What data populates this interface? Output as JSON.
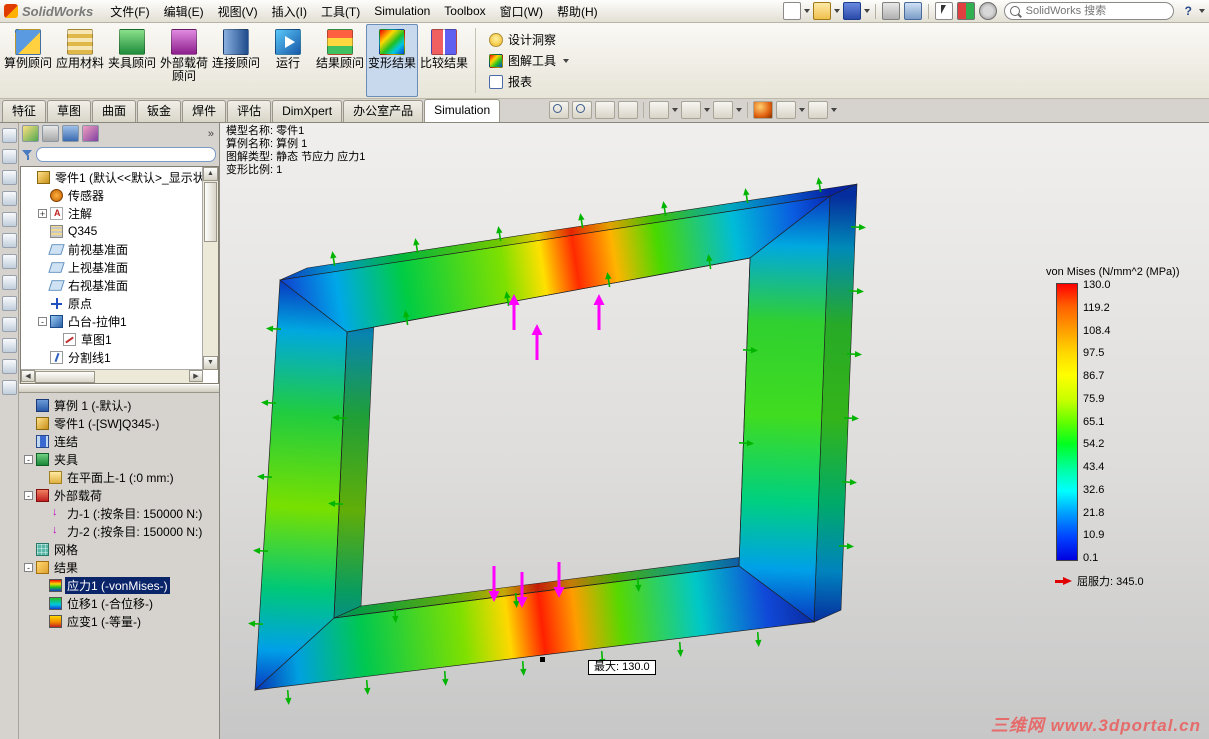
{
  "titlebar": {
    "logo": "SolidWorks",
    "menus": [
      {
        "label": "文件(F)"
      },
      {
        "label": "编辑(E)"
      },
      {
        "label": "视图(V)"
      },
      {
        "label": "插入(I)"
      },
      {
        "label": "工具(T)"
      },
      {
        "label": "Simulation"
      },
      {
        "label": "Toolbox"
      },
      {
        "label": "窗口(W)"
      },
      {
        "label": "帮助(H)"
      }
    ],
    "search_placeholder": "SolidWorks 搜索",
    "help_label": "?"
  },
  "ribbon": {
    "main_buttons": [
      {
        "label": "算例顾问",
        "icon": "ri-study"
      },
      {
        "label": "应用材料",
        "icon": "ri-material"
      },
      {
        "label": "夹具顾问",
        "icon": "ri-fixture"
      },
      {
        "label": "外部载荷顾问",
        "icon": "ri-load"
      },
      {
        "label": "连接顾问",
        "icon": "ri-connect"
      },
      {
        "label": "运行",
        "icon": "ri-run"
      },
      {
        "label": "结果顾问",
        "icon": "ri-resultadv"
      },
      {
        "label": "变形结果",
        "icon": "ri-deform",
        "active": true
      },
      {
        "label": "比较结果",
        "icon": "ri-compare"
      }
    ],
    "side_buttons": [
      {
        "label": "设计洞察",
        "icon": "si-insight"
      },
      {
        "label": "图解工具",
        "icon": "si-plot",
        "dropdown": true
      },
      {
        "label": "报表",
        "icon": "si-report"
      }
    ]
  },
  "tabs": {
    "items": [
      {
        "label": "特征"
      },
      {
        "label": "草图"
      },
      {
        "label": "曲面"
      },
      {
        "label": "钣金"
      },
      {
        "label": "焊件"
      },
      {
        "label": "评估"
      },
      {
        "label": "DimXpert"
      },
      {
        "label": "办公室产品"
      },
      {
        "label": "Simulation",
        "active": true
      }
    ]
  },
  "left_panel": {
    "feature_tree": {
      "root": {
        "label": "零件1 (默认<<默认>_显示状",
        "icon": "ti-part"
      },
      "items": [
        {
          "tw": "",
          "icon": "ti-sensor",
          "label": "传感器",
          "indent": 1
        },
        {
          "tw": "+",
          "icon": "ti-note",
          "label": "注解",
          "indent": 1
        },
        {
          "tw": "",
          "icon": "ti-material",
          "label": "Q345",
          "indent": 1
        },
        {
          "tw": "",
          "icon": "ti-plane",
          "label": "前视基准面",
          "indent": 1
        },
        {
          "tw": "",
          "icon": "ti-plane",
          "label": "上视基准面",
          "indent": 1
        },
        {
          "tw": "",
          "icon": "ti-plane",
          "label": "右视基准面",
          "indent": 1
        },
        {
          "tw": "",
          "icon": "ti-origin",
          "label": "原点",
          "indent": 1
        },
        {
          "tw": "-",
          "icon": "ti-extrude",
          "label": "凸台-拉伸1",
          "indent": 1
        },
        {
          "tw": "",
          "icon": "ti-sketch",
          "label": "草图1",
          "indent": 2
        },
        {
          "tw": "",
          "icon": "ti-split",
          "label": "分割线1",
          "indent": 1
        }
      ]
    },
    "study_tree": {
      "items": [
        {
          "tw": "",
          "icon": "ti-study",
          "label": "算例 1 (-默认-)",
          "indent": 0
        },
        {
          "tw": "",
          "icon": "ti-part",
          "label": "零件1 (-[SW]Q345-)",
          "indent": 0
        },
        {
          "tw": "",
          "icon": "ti-connect",
          "label": "连结",
          "indent": 0
        },
        {
          "tw": "-",
          "icon": "ti-fixture",
          "label": "夹具",
          "indent": 0
        },
        {
          "tw": "",
          "icon": "ti-flat",
          "label": "在平面上-1 (:0 mm:)",
          "indent": 1
        },
        {
          "tw": "-",
          "icon": "ti-loads",
          "label": "外部载荷",
          "indent": 0
        },
        {
          "tw": "",
          "icon": "ti-force",
          "label": "力-1 (:按条目: 150000 N:)",
          "indent": 1
        },
        {
          "tw": "",
          "icon": "ti-force",
          "label": "力-2 (:按条目: 150000 N:)",
          "indent": 1
        },
        {
          "tw": "",
          "icon": "ti-mesh",
          "label": "网格",
          "indent": 0
        },
        {
          "tw": "-",
          "icon": "ti-results",
          "label": "结果",
          "indent": 0
        },
        {
          "tw": "",
          "icon": "ti-stress",
          "label": "应力1 (-vonMises-)",
          "indent": 1,
          "selected": true
        },
        {
          "tw": "",
          "icon": "ti-disp",
          "label": "位移1 (-合位移-)",
          "indent": 1
        },
        {
          "tw": "",
          "icon": "ti-strain",
          "label": "应变1 (-等量-)",
          "indent": 1
        }
      ]
    }
  },
  "viewport": {
    "annotation": {
      "line1": "模型名称: 零件1",
      "line2": "算例名称: 算例 1",
      "line3": "图解类型: 静态 节应力 应力1",
      "line4": "变形比例: 1"
    },
    "max_label": "最大:  130.0"
  },
  "legend": {
    "title": "von Mises (N/mm^2 (MPa))",
    "values": [
      {
        "v": "130.0"
      },
      {
        "v": "119.2"
      },
      {
        "v": "108.4"
      },
      {
        "v": "97.5"
      },
      {
        "v": "86.7"
      },
      {
        "v": "75.9"
      },
      {
        "v": "65.1"
      },
      {
        "v": "54.2"
      },
      {
        "v": "43.4"
      },
      {
        "v": "32.6"
      },
      {
        "v": "21.8"
      },
      {
        "v": "10.9"
      },
      {
        "v": "0.1"
      }
    ],
    "yield_label": "屈服力: 345.0"
  },
  "watermark": "三维网 www.3dportal.cn",
  "colors": {
    "selection": "#0a246a",
    "fixture_arrow": "#00b400",
    "load_arrow": "#ff00ff",
    "legend_max": "#ff0000",
    "legend_min": "#0000e0",
    "active_button_bg": "#c8d9ee"
  }
}
